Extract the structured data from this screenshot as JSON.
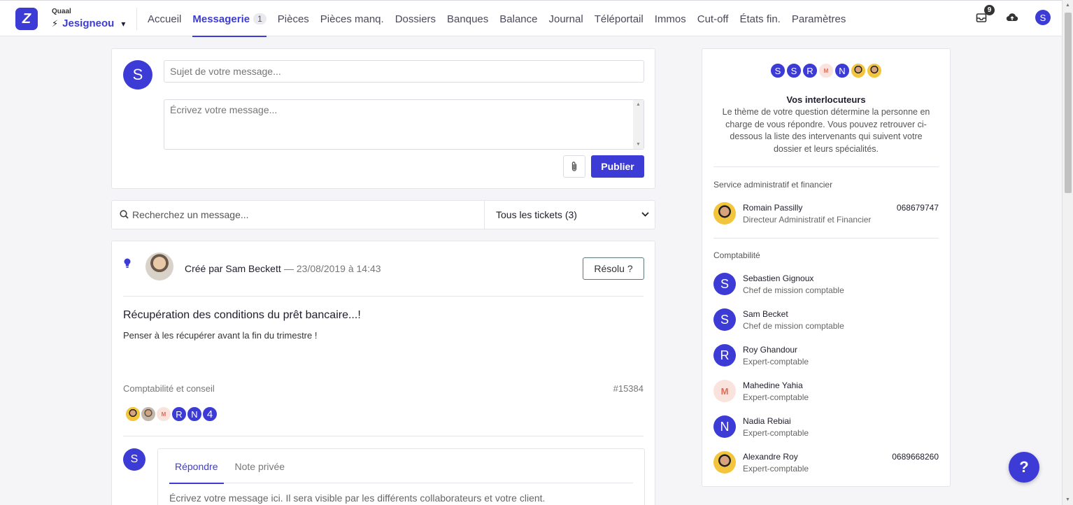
{
  "company": {
    "label": "Quaal",
    "name": "Jesigneou"
  },
  "nav": {
    "items": [
      {
        "label": "Accueil"
      },
      {
        "label": "Messagerie",
        "badge": "1",
        "active": true
      },
      {
        "label": "Pièces"
      },
      {
        "label": "Pièces manq."
      },
      {
        "label": "Dossiers"
      },
      {
        "label": "Banques"
      },
      {
        "label": "Balance"
      },
      {
        "label": "Journal"
      },
      {
        "label": "Téléportail"
      },
      {
        "label": "Immos"
      },
      {
        "label": "Cut-off"
      },
      {
        "label": "États fin."
      },
      {
        "label": "Paramètres"
      }
    ]
  },
  "topbar": {
    "notifications_count": "9",
    "user_initial": "S",
    "icons": [
      "inbox-icon",
      "cloud-upload-icon"
    ]
  },
  "compose": {
    "avatar": "S",
    "subject_placeholder": "Sujet de votre message...",
    "message_placeholder": "Écrivez votre message...",
    "publish_label": "Publier"
  },
  "search": {
    "placeholder": "Recherchez un message...",
    "filter_value": "Tous les tickets (3)"
  },
  "ticket": {
    "created_by": "Créé par Sam Beckett",
    "date": "— 23/08/2019 à 14:43",
    "resolved_label": "Résolu ?",
    "title": "Récupération des conditions du prêt bancaire...!",
    "body": "Penser à les récupérer avant la fin du trimestre !",
    "category": "Comptabilité et conseil",
    "id": "#15384",
    "participants": [
      "M",
      "R",
      "N"
    ],
    "participants_more": "4",
    "reply": {
      "avatar": "S",
      "tab_reply": "Répondre",
      "tab_note": "Note privée",
      "placeholder": "Écrivez votre message ici. Il sera visible par les différents collaborateurs et votre client."
    }
  },
  "side": {
    "avatars": [
      "S",
      "S",
      "R",
      "M",
      "N"
    ],
    "title": "Vos interlocuteurs",
    "description": "Le thème de votre question détermine la personne en charge de vous répondre. Vous pouvez retrouver ci-dessous la liste des intervenants qui suivent votre dossier et leurs spécialités.",
    "section_admin": "Service administratif et financier",
    "section_compta": "Comptabilité",
    "admin": [
      {
        "name": "Romain Passilly",
        "role": "Directeur Administratif et Financier",
        "phone": "068679747"
      }
    ],
    "compta": [
      {
        "initial": "S",
        "name": "Sebastien Gignoux",
        "role": "Chef de mission comptable",
        "phone": ""
      },
      {
        "initial": "S",
        "name": "Sam Becket",
        "role": "Chef de mission comptable",
        "phone": ""
      },
      {
        "initial": "R",
        "name": "Roy Ghandour",
        "role": "Expert-comptable",
        "phone": ""
      },
      {
        "initial": "M",
        "name": "Mahedine Yahia",
        "role": "Expert-comptable",
        "phone": ""
      },
      {
        "initial": "N",
        "name": "Nadia Rebiai",
        "role": "Expert-comptable",
        "phone": ""
      },
      {
        "initial": "",
        "name": "Alexandre Roy",
        "role": "Expert-comptable",
        "phone": "0689668260"
      }
    ]
  },
  "help_label": "?",
  "colors": {
    "accent": "#3d3bd6",
    "background": "#f5f5f8"
  }
}
